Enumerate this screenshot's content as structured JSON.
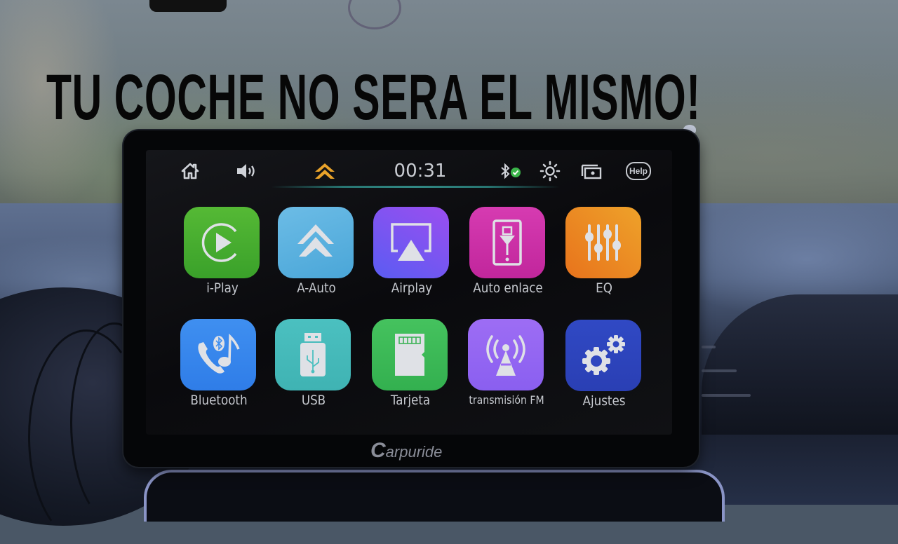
{
  "headline": "TU COCHE NO SERA EL MISMO!",
  "status_bar": {
    "home_icon": "home-icon",
    "volume_icon": "volume-icon",
    "nav_icon": "navigation-arrows-icon",
    "clock": "00:31",
    "bluetooth_icon": "bluetooth-connected-icon",
    "brightness_icon": "brightness-icon",
    "screen_icon": "screen-mirror-icon",
    "help_label": "Help",
    "accent_color": "#e8a22a",
    "connected_color": "#3bb54a"
  },
  "apps": [
    {
      "label": "i-Play",
      "icon": "play-circle-icon",
      "color": "#3aa12a",
      "color2": "#55b935"
    },
    {
      "label": "A-Auto",
      "icon": "double-chevron-up-icon",
      "color": "#4aa6d8",
      "color2": "#6cbce6"
    },
    {
      "label": "Airplay",
      "icon": "airplay-icon",
      "color": "#5a5cf2",
      "color2": "#9b4ef0"
    },
    {
      "label": "Auto enlace",
      "icon": "phone-usb-icon",
      "color": "#c1269c",
      "color2": "#d63bb1"
    },
    {
      "label": "EQ",
      "icon": "equalizer-sliders-icon",
      "color": "#e8731c",
      "color2": "#eea22a"
    },
    {
      "label": "Bluetooth",
      "icon": "bluetooth-phone-music-icon",
      "color": "#2f7de8",
      "color2": "#3f8ff0"
    },
    {
      "label": "USB",
      "icon": "usb-drive-icon",
      "color": "#3fb3b3",
      "color2": "#4bc0c0"
    },
    {
      "label": "Tarjeta",
      "icon": "sd-card-icon",
      "color": "#33b04f",
      "color2": "#45c25e"
    },
    {
      "label": "transmisión FM",
      "icon": "radio-tower-icon",
      "color": "#8a5ff0",
      "color2": "#9d6df4"
    },
    {
      "label": "Ajustes",
      "icon": "gears-icon",
      "color": "#2a3fb4",
      "color2": "#3049c4"
    }
  ],
  "brand": {
    "initial": "C",
    "rest": "arpuride"
  }
}
